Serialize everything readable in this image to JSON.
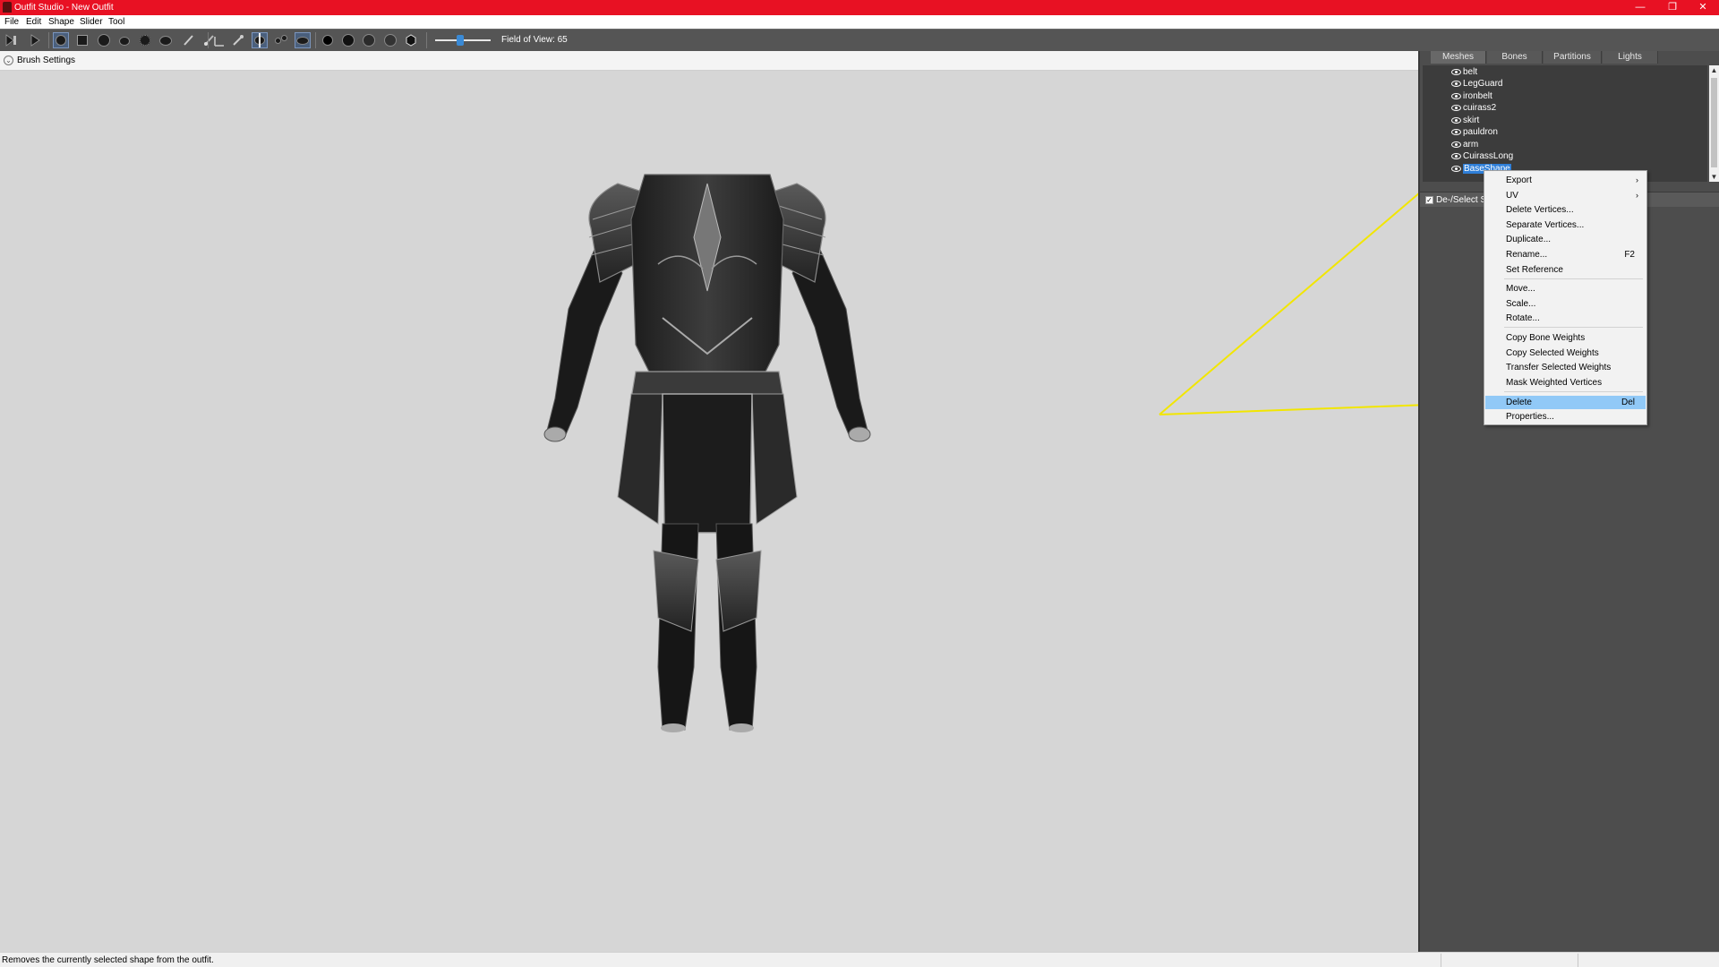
{
  "window": {
    "title": "Outfit Studio - New Outfit"
  },
  "menubar": {
    "items": [
      "File",
      "Edit",
      "Shape",
      "Slider",
      "Tool"
    ]
  },
  "toolbar": {
    "field_of_view_label": "Field of View: 65",
    "field_of_view_slider": 0.4,
    "icons": [
      "select-icon",
      "transform-icon",
      "brush-standard-icon",
      "brush-mask-icon",
      "brush-inflate-icon",
      "brush-deflate-icon",
      "brush-move-icon",
      "brush-smooth-icon",
      "brush-weight-icon",
      "brush-color-icon",
      "pen-icon",
      "pipette-icon",
      "mirror-x-icon",
      "connected-icon",
      "global-icon",
      "sphere-icon",
      "dark-sphere-icon",
      "light-sphere-icon",
      "shade-icon",
      "texture-icon"
    ]
  },
  "viewport": {
    "brush_settings_label": "Brush Settings"
  },
  "panel": {
    "tabs": [
      "Meshes",
      "Bones",
      "Partitions",
      "Lights"
    ],
    "meshes": [
      "belt",
      "LegGuard",
      "ironbelt",
      "cuirass2",
      "skirt",
      "pauldron",
      "arm",
      "CuirassLong",
      "BaseShape"
    ],
    "selected_mesh": "BaseShape",
    "slider_toggle_label": "De-/Select Sliders"
  },
  "context_menu": {
    "items": [
      {
        "label": "Export",
        "submenu": "›"
      },
      {
        "label": "UV",
        "submenu": "›"
      },
      {
        "label": "Delete Vertices..."
      },
      {
        "label": "Separate Vertices..."
      },
      {
        "label": "Duplicate..."
      },
      {
        "label": "Rename...",
        "shortcut": "F2"
      },
      {
        "label": "Set Reference"
      },
      {
        "label": "Move..."
      },
      {
        "label": "Scale..."
      },
      {
        "label": "Rotate..."
      },
      {
        "label": "Copy Bone Weights"
      },
      {
        "label": "Copy Selected Weights"
      },
      {
        "label": "Transfer Selected Weights"
      },
      {
        "label": "Mask Weighted Vertices"
      },
      {
        "label": "Delete",
        "shortcut": "Del",
        "highlighted": true
      },
      {
        "label": "Properties..."
      }
    ]
  },
  "statusbar": {
    "text": "Removes the currently selected shape from the outfit."
  },
  "colors": {
    "titlebar": "#e81123",
    "selection": "#2f7fd8",
    "menu_highlight": "#91c9f7",
    "annotation": "#f2e600"
  }
}
